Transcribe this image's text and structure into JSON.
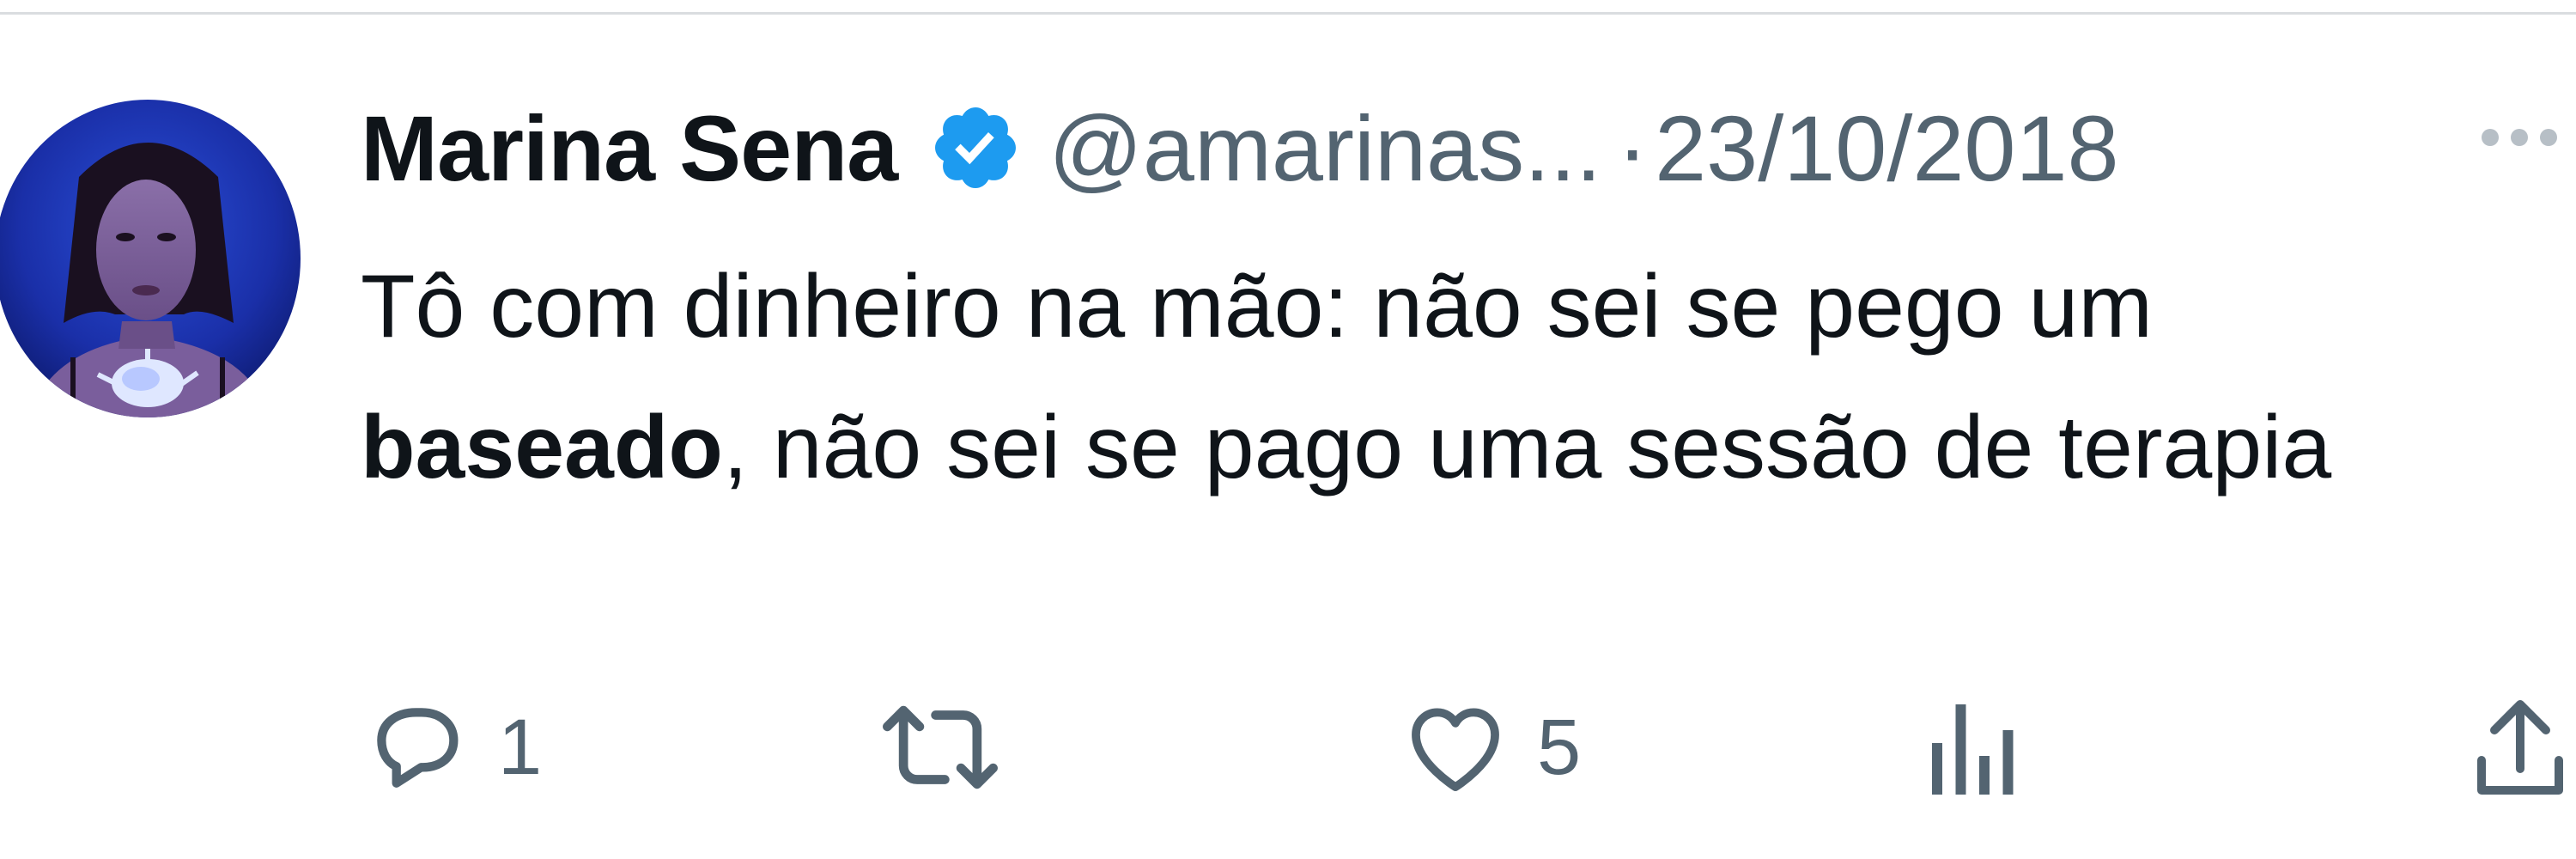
{
  "tweet": {
    "display_name": "Marina Sena",
    "handle": "@amarinas...",
    "separator": "·",
    "date": "23/10/2018",
    "text_part1": "Tô com dinheiro na mão: não sei se pego um",
    "text_bold": "baseado",
    "text_part2": ", não sei se pago uma sessão de terapia",
    "verified_color": "#1d9bf0"
  },
  "actions": {
    "reply_count": "1",
    "retweet_count": "",
    "like_count": "5",
    "views_count": ""
  },
  "icons": {
    "avatar": "avatar-photo",
    "verified": "verified-badge-icon",
    "more": "more-options-icon",
    "reply": "reply-icon",
    "retweet": "retweet-icon",
    "like": "heart-icon",
    "views": "views-icon",
    "share": "share-icon"
  },
  "colors": {
    "text_primary": "#0f1419",
    "text_secondary": "#536471",
    "divider": "#dadde0",
    "accent": "#1d9bf0"
  }
}
